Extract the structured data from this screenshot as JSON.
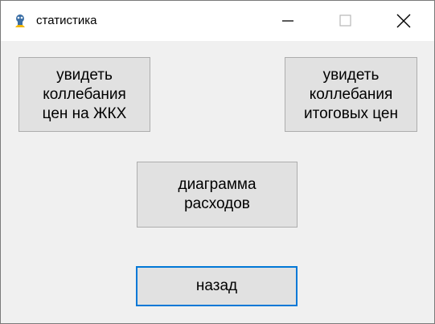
{
  "window": {
    "title": "статистика",
    "icons": {
      "app": "app-icon",
      "minimize": "minimize-icon",
      "maximize": "maximize-icon",
      "close": "close-icon"
    }
  },
  "buttons": {
    "utility_prices": "увидеть\nколлебания\nцен на ЖКХ",
    "total_prices": "увидеть\nколлебания\nитоговых цен",
    "expense_diagram": "диаграмма\nрасходов",
    "back": "назад"
  },
  "colors": {
    "window_bg": "#f0f0f0",
    "button_bg": "#e1e1e1",
    "button_border": "#adadad",
    "focus_border": "#0078d7"
  }
}
